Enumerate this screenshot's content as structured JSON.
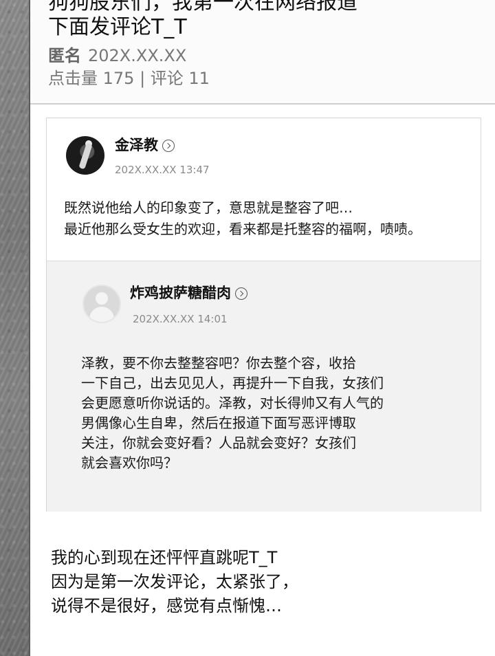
{
  "article": {
    "title_line1": "狗狗股东们，我第一次在网络报道",
    "title_line2": "下面发评论T_T",
    "author": "匿名",
    "date": "202X.XX.XX",
    "stats": "点击量 175 | 评论 11"
  },
  "comment": {
    "username": "金泽教",
    "time": "202X.XX.XX 13:47",
    "lines": [
      "既然说他给人的印象变了，意思就是整容了吧…",
      "最近他那么受女生的欢迎，看来都是托整容的福啊，啧啧。"
    ]
  },
  "reply": {
    "username": "炸鸡披萨糖醋肉",
    "time": "202X.XX.XX 14:01",
    "lines": [
      "泽教，要不你去整整容吧？你去整个容，收拾",
      "一下自己，出去见见人，再提升一下自我，女孩们",
      "会更愿意听你说话的。泽教，对长得帅又有人气的",
      "男偶像心生自卑，然后在报道下面写恶评博取",
      "关注，你就会变好看？人品就会变好？女孩们",
      "就会喜欢你吗？"
    ]
  },
  "closing": {
    "lines": [
      "我的心到现在还怦怦直跳呢T_T",
      "因为是第一次发评论，太紧张了，",
      "说得不是很好，感觉有点惭愧…"
    ]
  },
  "icons": {
    "profile_link": "chevron-right-circle-icon",
    "default_avatar": "default-avatar-icon"
  }
}
